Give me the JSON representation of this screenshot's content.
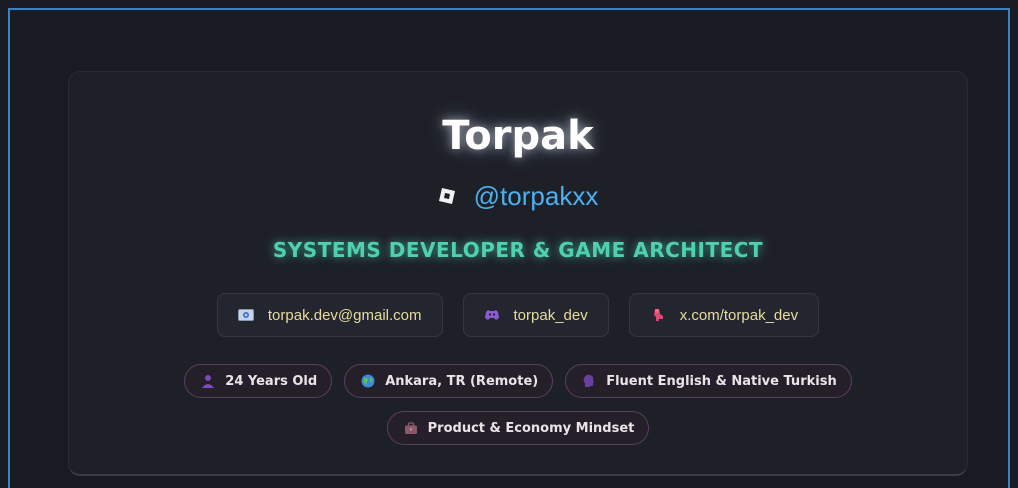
{
  "profile": {
    "name": "Torpak",
    "handle": "@torpakxx",
    "handle_icon": "roblox-icon",
    "role": "SYSTEMS DEVELOPER & GAME ARCHITECT"
  },
  "contacts": [
    {
      "label": "torpak.dev@gmail.com",
      "icon": "email-icon"
    },
    {
      "label": "torpak_dev",
      "icon": "discord-icon"
    },
    {
      "label": "x.com/torpak_dev",
      "icon": "x-social-icon"
    }
  ],
  "tags": [
    {
      "label": "24 Years Old",
      "icon": "person-icon"
    },
    {
      "label": "Ankara, TR (Remote)",
      "icon": "globe-icon"
    },
    {
      "label": "Fluent English & Native Turkish",
      "icon": "speaking-head-icon"
    },
    {
      "label": "Product & Economy Mindset",
      "icon": "briefcase-icon"
    }
  ],
  "colors": {
    "accent_blue": "#4cb0f0",
    "role_green": "#4fd1ae",
    "contact_text": "#e9dba0",
    "tag_border": "#5b3f63",
    "frame_border": "#3b82c4"
  }
}
